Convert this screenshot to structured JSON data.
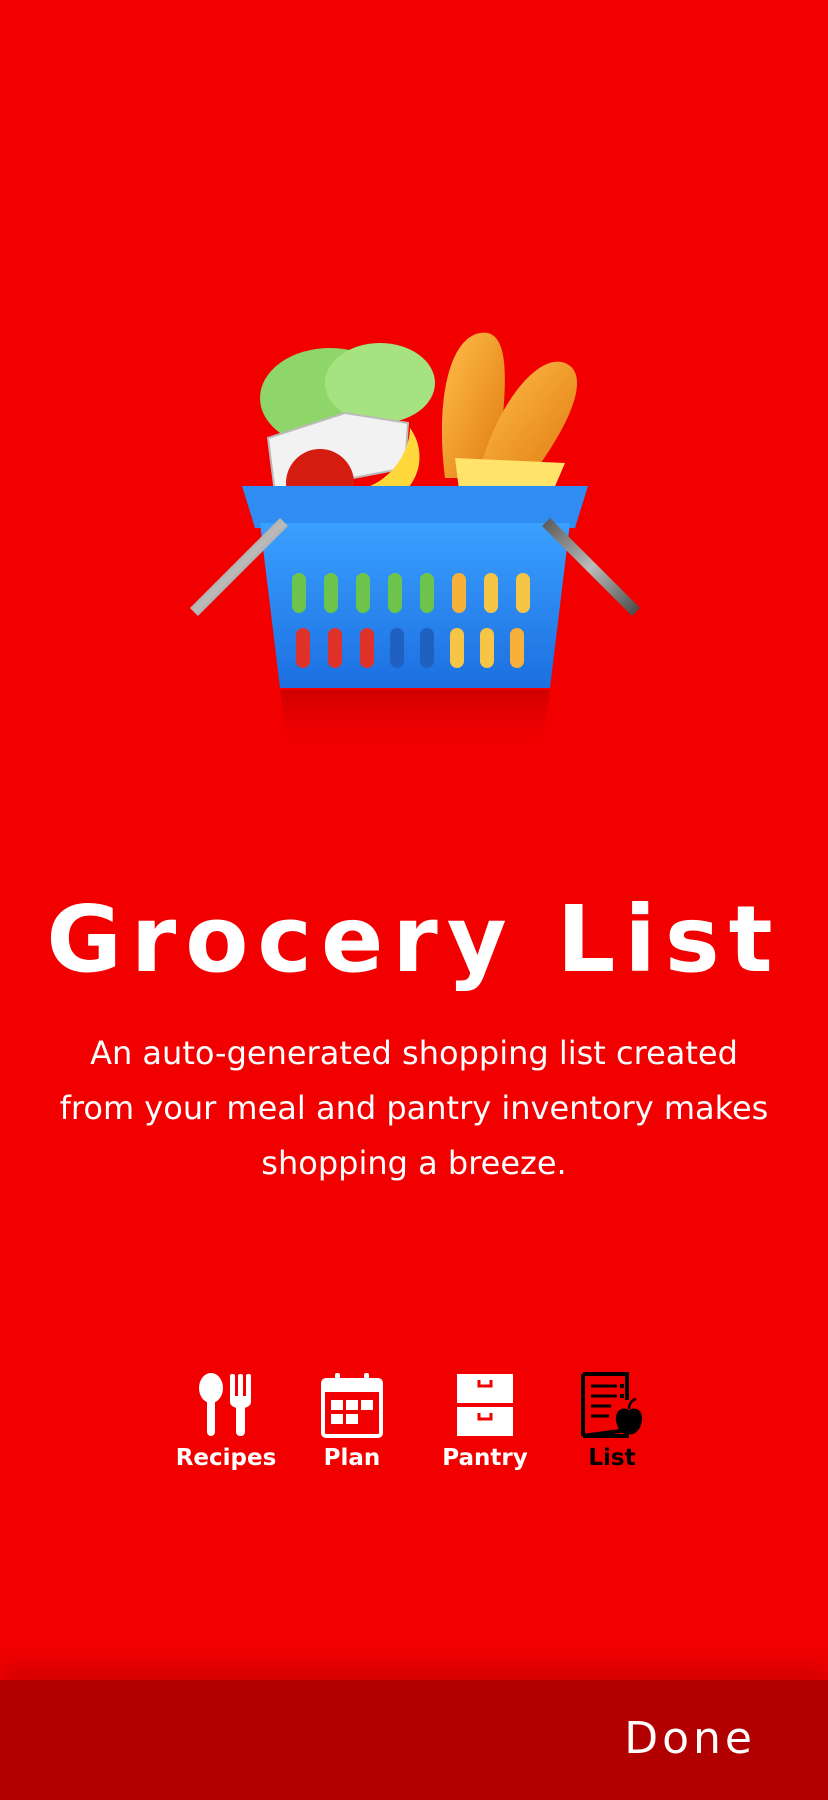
{
  "onboarding": {
    "title": "Grocery List",
    "description": "An auto-generated shopping list created from your meal and pantry inventory makes shopping a breeze."
  },
  "feature_icons": [
    {
      "label": "Recipes",
      "icon": "spoon-fork-icon",
      "active": false
    },
    {
      "label": "Plan",
      "icon": "calendar-icon",
      "active": false
    },
    {
      "label": "Pantry",
      "icon": "drawers-icon",
      "active": false
    },
    {
      "label": "List",
      "icon": "list-apple-icon",
      "active": true
    }
  ],
  "footer": {
    "done_label": "Done"
  },
  "colors": {
    "background": "#f20000",
    "footer_bar": "#b20000",
    "active_icon": "#000000",
    "inactive_icon": "#ffffff"
  }
}
